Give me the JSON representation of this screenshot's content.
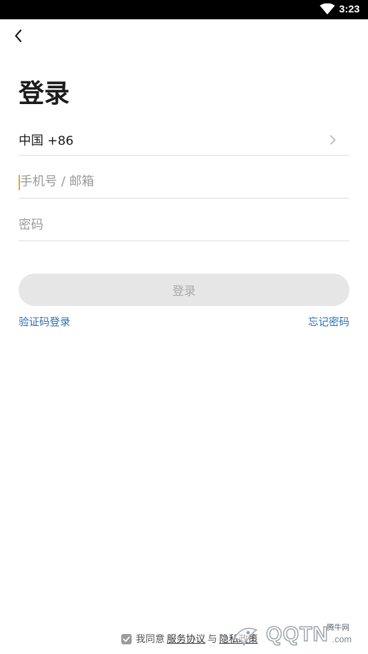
{
  "status_bar": {
    "time": "3:23"
  },
  "page": {
    "title": "登录"
  },
  "country": {
    "label": "中国 +86"
  },
  "phone": {
    "placeholder": "手机号 / 邮箱",
    "value": ""
  },
  "password": {
    "placeholder": "密码",
    "value": ""
  },
  "login_button": {
    "label": "登录"
  },
  "links": {
    "sms_login": "验证码登录",
    "forgot_password": "忘记密码"
  },
  "agreement": {
    "prefix": "我同意",
    "terms": "服务协议",
    "and": "与",
    "privacy": "隐私政策",
    "checked": true
  },
  "watermark": {
    "text": "QQTN",
    "suffix": ".com",
    "cn": "腾牛网"
  },
  "colors": {
    "link": "#2d6fb6",
    "button_bg": "#e6e6e6",
    "cursor": "#e0a531"
  }
}
